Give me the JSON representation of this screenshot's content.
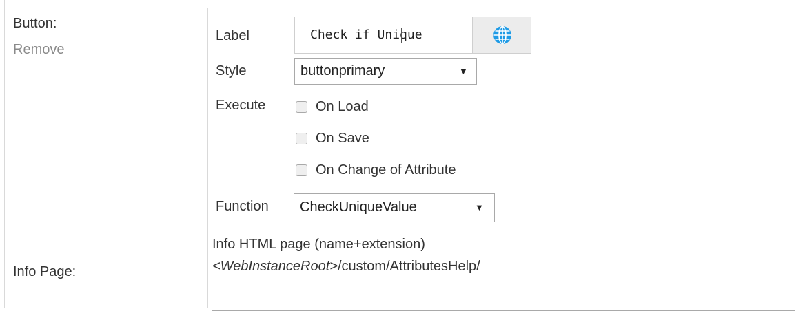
{
  "button_row": {
    "title": "Button:",
    "remove_link": "Remove",
    "label_caption": "Label",
    "label_value": "Check if Unique",
    "globe_icon": "globe-icon",
    "style_caption": "Style",
    "style_value": "buttonprimary",
    "execute_caption": "Execute",
    "execute_options": [
      {
        "label": "On Load",
        "checked": false
      },
      {
        "label": "On Save",
        "checked": false
      },
      {
        "label": "On Change of Attribute",
        "checked": false
      }
    ],
    "function_caption": "Function",
    "function_value": "CheckUniqueValue"
  },
  "info_row": {
    "title": "Info Page:",
    "hint_line1": "Info HTML page (name+extension)",
    "hint_root": "<WebInstanceRoot>",
    "hint_path": "/custom/AttributesHelp/",
    "input_value": ""
  },
  "colors": {
    "text": "#333333",
    "muted": "#8a8a8a",
    "border": "#d9d9d9",
    "globe": "#1e9be6"
  }
}
